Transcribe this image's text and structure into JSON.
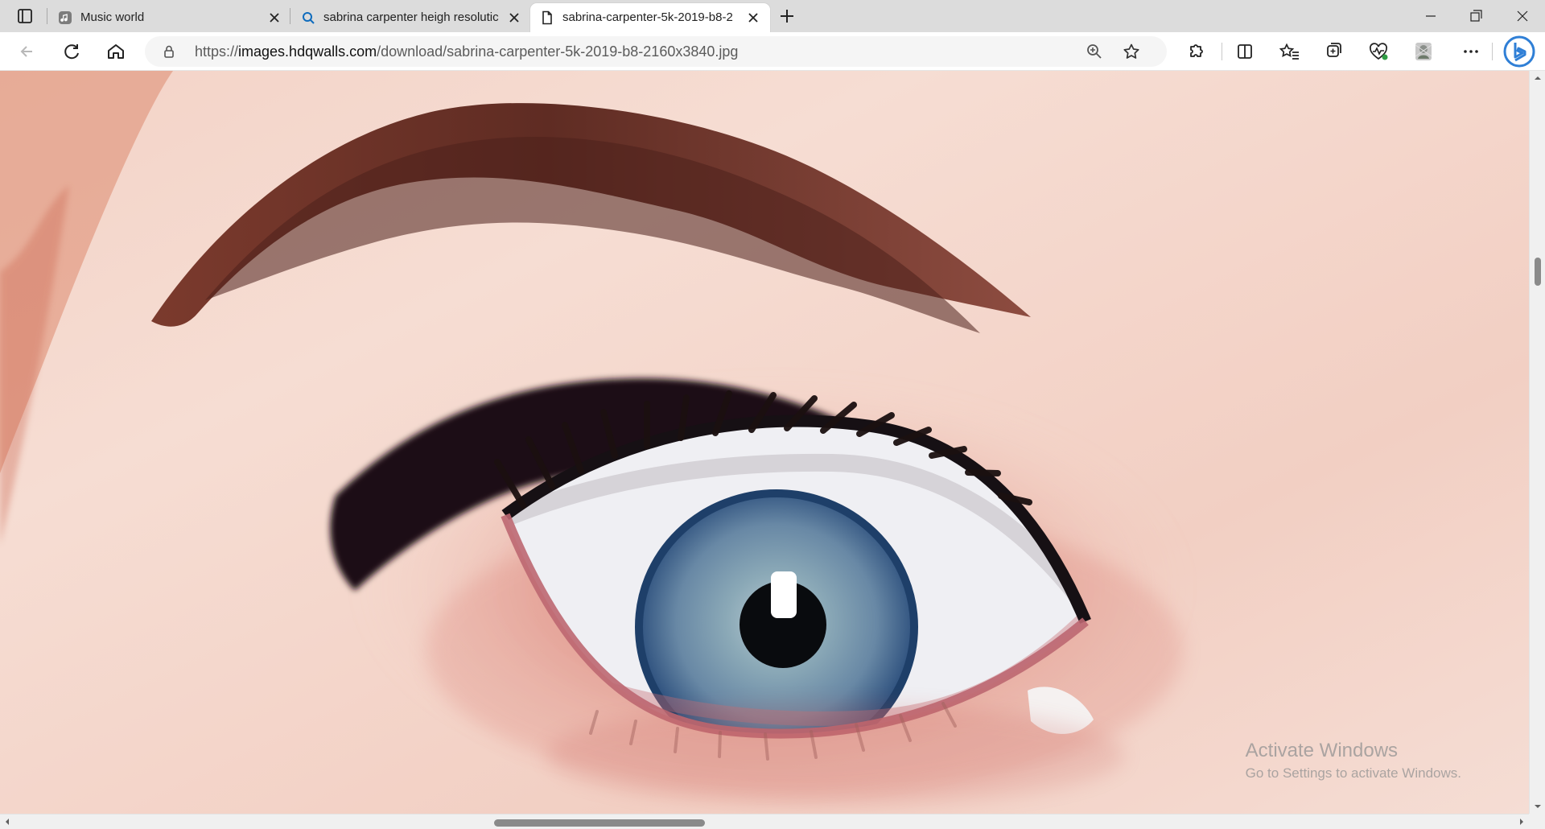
{
  "browser": {
    "tabs": [
      {
        "title": "Music world",
        "icon": "music-note-icon"
      },
      {
        "title": "sabrina carpenter heigh resolutic",
        "icon": "search-icon"
      },
      {
        "title": "sabrina-carpenter-5k-2019-b8-2",
        "icon": "document-icon"
      }
    ],
    "address": {
      "url_prefix": "https://",
      "url_host": "images.hdqwalls.com",
      "url_path": "/download/sabrina-carpenter-5k-2019-b8-2160x3840.jpg"
    }
  },
  "watermark": {
    "title": "Activate Windows",
    "subtitle": "Go to Settings to activate Windows."
  },
  "colors": {
    "tabbar": "#dcdcdc",
    "toolbar": "#ffffff",
    "accent": "#0f6cbd",
    "image_skin": "#f6ddd2"
  },
  "icons": {
    "back": "back-arrow-icon",
    "refresh": "refresh-icon",
    "home": "home-icon",
    "lock": "lock-icon",
    "zoom": "zoom-icon",
    "favorite": "star-icon",
    "extensions": "puzzle-icon",
    "split_screen": "split-screen-icon",
    "favorites": "favorites-icon",
    "collections": "collections-icon",
    "performance": "heart-pulse-icon",
    "profile": "profile-avatar-icon",
    "more": "more-icon",
    "bing": "bing-icon"
  }
}
